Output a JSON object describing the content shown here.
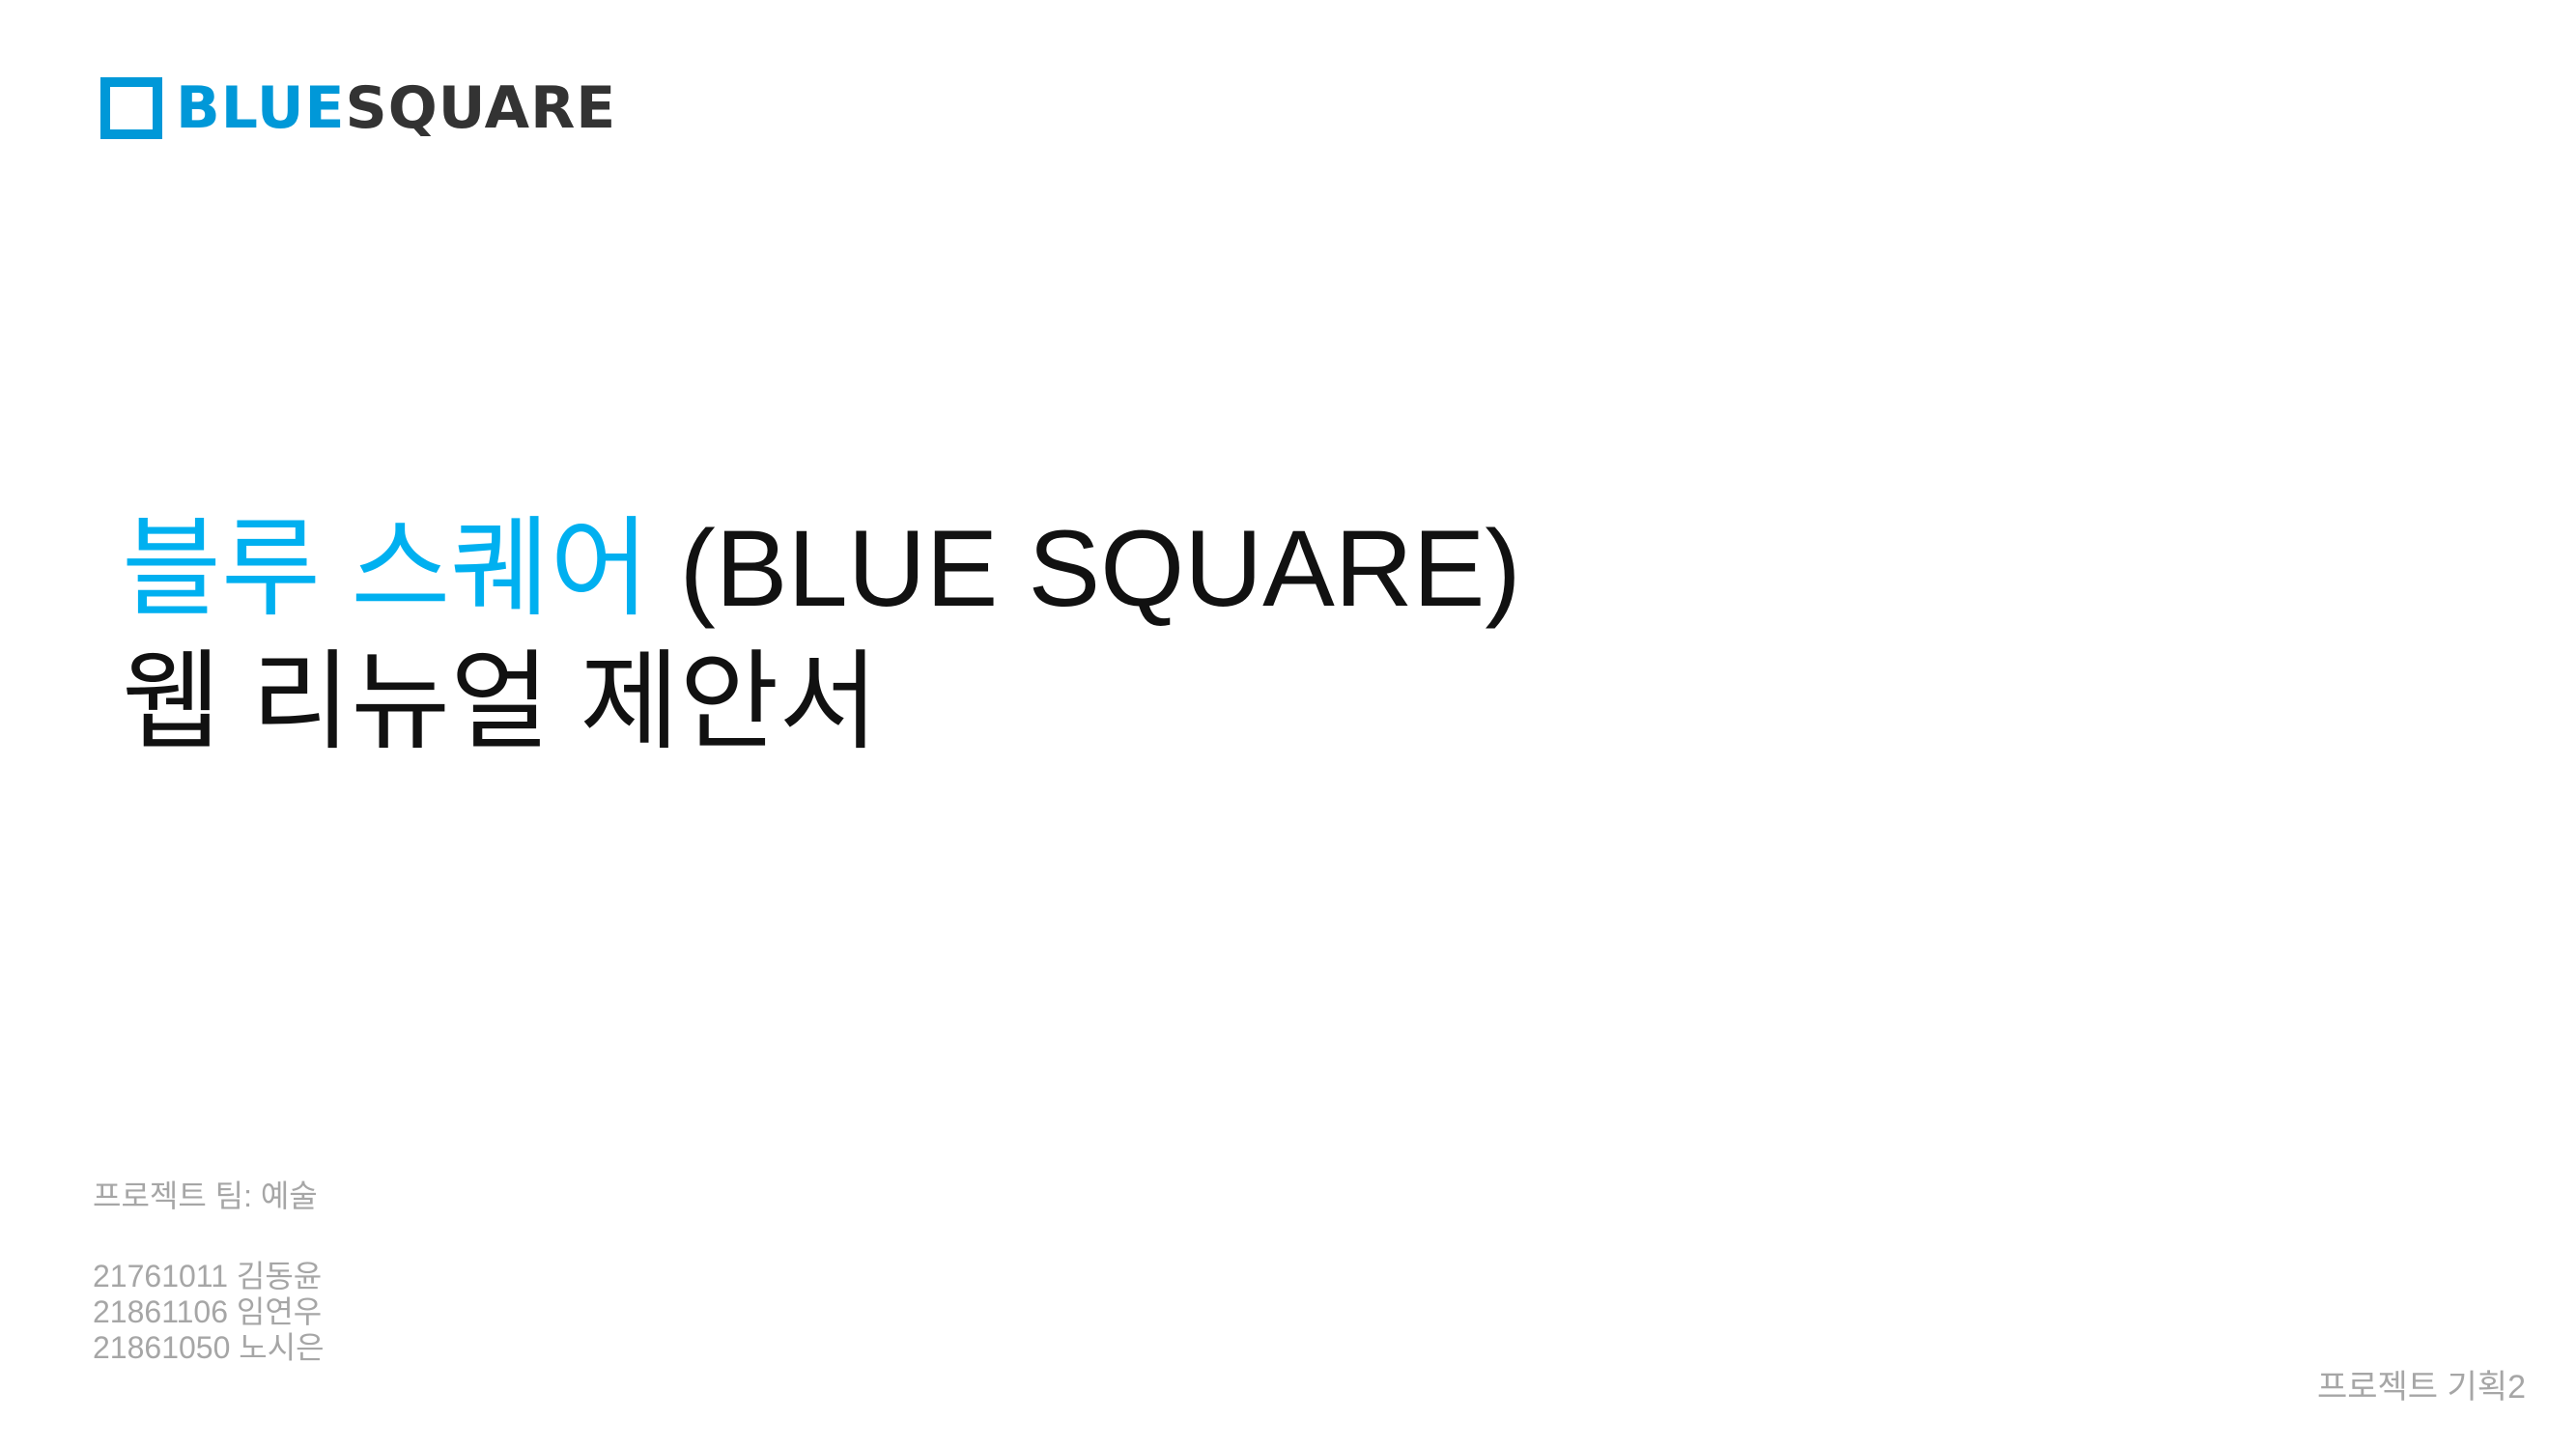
{
  "logo": {
    "part1": "BLUE",
    "part2": "SQUARE",
    "colors": {
      "blue": "#0098d8",
      "dark": "#333333"
    }
  },
  "title": {
    "line1_accent": "블루 스퀘어",
    "line1_rest": " (BLUE SQUARE)",
    "line2": "웹 리뉴얼 제안서",
    "accent_color": "#00b0f0"
  },
  "team": {
    "label": "프로젝트 팀: 예술",
    "members": [
      "21761011 김동윤",
      "21861106 임연우",
      "21861050 노시은"
    ]
  },
  "footer": {
    "course": "프로젝트 기획2"
  }
}
